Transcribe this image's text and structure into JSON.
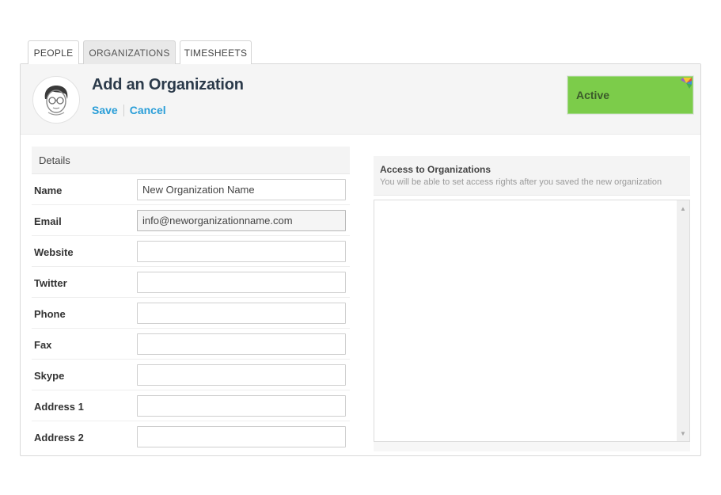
{
  "tabs": [
    {
      "label": "PEOPLE"
    },
    {
      "label": "ORGANIZATIONS"
    },
    {
      "label": "TIMESHEETS"
    }
  ],
  "active_tab": "ORGANIZATIONS",
  "header": {
    "title": "Add an Organization",
    "save_label": "Save",
    "cancel_label": "Cancel",
    "status_label": "Active"
  },
  "details": {
    "section_title": "Details",
    "fields": [
      {
        "label": "Name",
        "value": "New Organization Name"
      },
      {
        "label": "Email",
        "value": "info@neworganizationname.com"
      },
      {
        "label": "Website",
        "value": ""
      },
      {
        "label": "Twitter",
        "value": ""
      },
      {
        "label": "Phone",
        "value": ""
      },
      {
        "label": "Fax",
        "value": ""
      },
      {
        "label": "Skype",
        "value": ""
      },
      {
        "label": "Address 1",
        "value": ""
      },
      {
        "label": "Address 2",
        "value": ""
      }
    ]
  },
  "access": {
    "title": "Access to Organizations",
    "subtitle": "You will be able to set access rights after you saved the new organization"
  },
  "colors": {
    "accent_link": "#2a9ed8",
    "status_active": "#7ccc4a",
    "title": "#2b3a4a"
  },
  "icons": {
    "avatar": "person-avatar-icon",
    "status_flag": "color-flag-icon",
    "scroll_up": "scroll-up-arrow-icon",
    "scroll_down": "scroll-down-arrow-icon"
  }
}
